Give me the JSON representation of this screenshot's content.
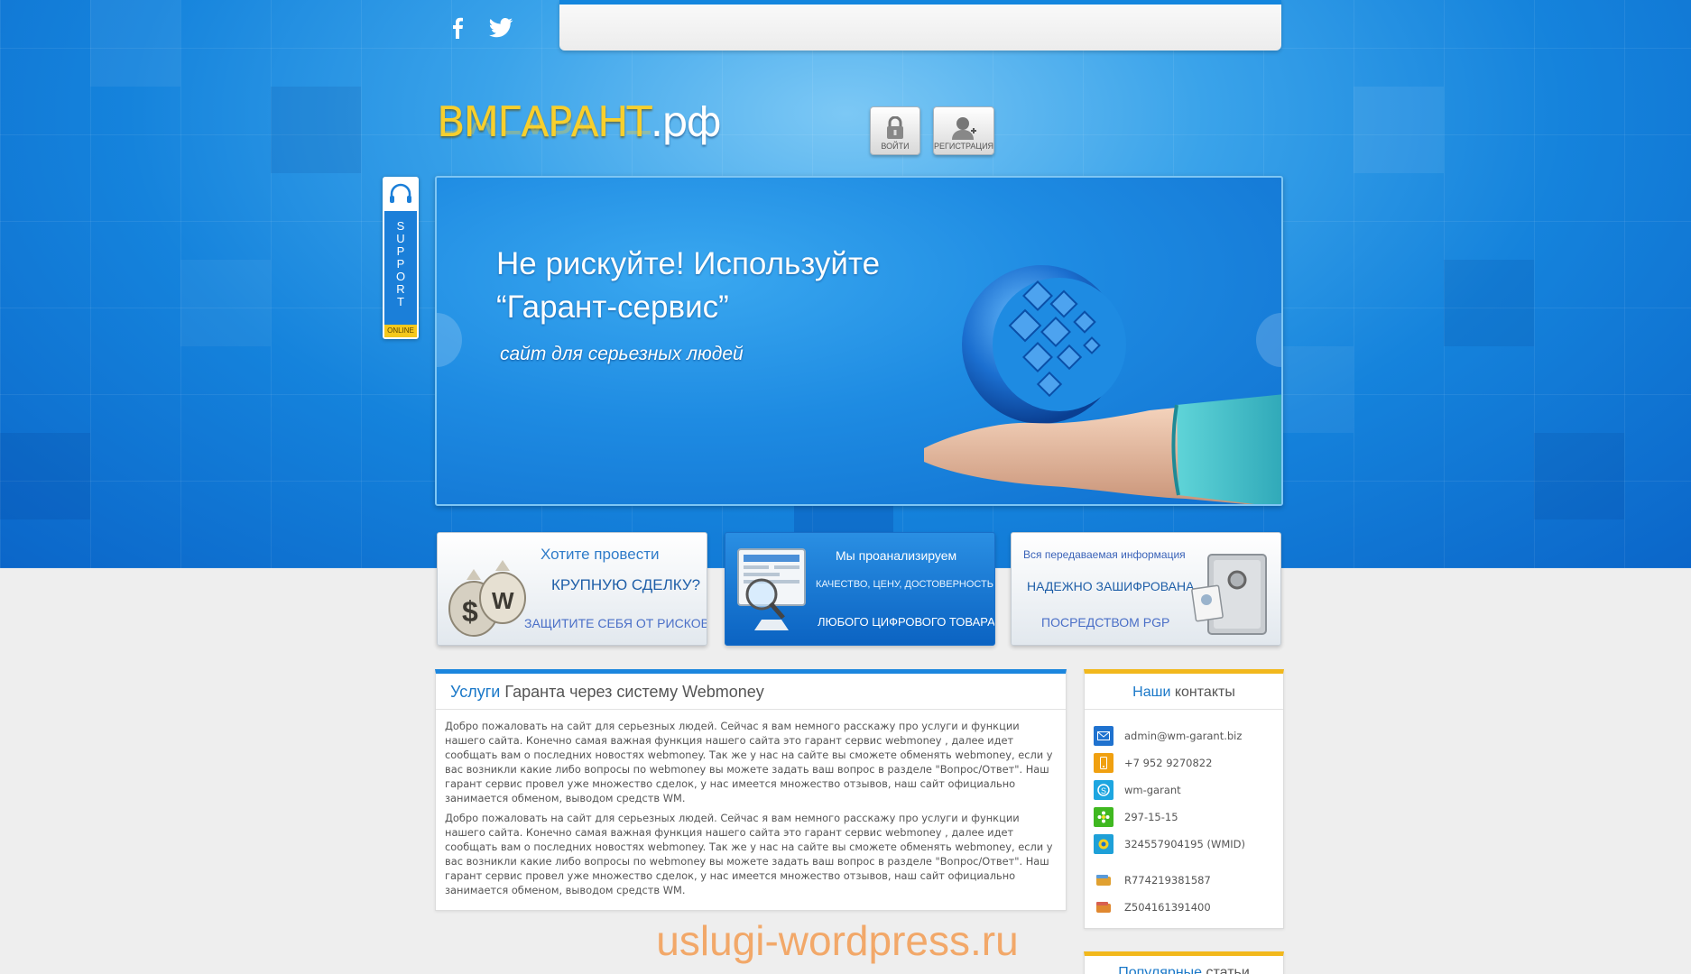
{
  "colors": {
    "accent": "#1a78c8",
    "brand_yellow": "#f7cf2d",
    "panel_border_orange": "#f2b81c"
  },
  "social": {
    "facebook_icon": "facebook-icon",
    "twitter_icon": "twitter-icon"
  },
  "logo": {
    "main": "ВМГАРАНТ",
    "domain": ".рф"
  },
  "auth": {
    "login_label": "ВОЙТИ",
    "register_label": "РЕГИСТРАЦИЯ"
  },
  "support": {
    "letters": [
      "S",
      "U",
      "P",
      "P",
      "O",
      "R",
      "T"
    ],
    "status": "ONLINE"
  },
  "hero": {
    "title_line1": "Не рискуйте! Используйте",
    "title_line2": "“Гарант-сервис”",
    "subtitle": "сайт для серьезных людей"
  },
  "features": [
    {
      "line1": "Хотите провести",
      "line2": "КРУПНУЮ СДЕЛКУ?",
      "line3": "ЗАЩИТИТЕ СЕБЯ ОТ РИСКОВ!"
    },
    {
      "line1": "Мы проанализируем",
      "line2": "КАЧЕСТВО, ЦЕНУ, ДОСТОВЕРНОСТЬ",
      "line3": "ЛЮБОГО ЦИФРОВОГО ТОВАРА"
    },
    {
      "line1": "Вся передаваемая информация",
      "line2": "НАДЕЖНО ЗАШИФРОВАНА",
      "line3": "ПОСРЕДСТВОМ PGP"
    }
  ],
  "services": {
    "title_accent": "Услуги",
    "title_rest": " Гаранта через систему Webmoney",
    "paragraphs": [
      "Добро пожаловать на сайт для серьезных людей. Сейчас я вам немного расскажу про услуги и функции нашего сайта. Конечно самая важная функция нашего сайта это гарант сервис webmoney , далее идет сообщать вам о последних новостях webmoney. Так же у нас на сайте вы сможете обменять webmoney, если у вас возникли какие либо вопросы по webmoney вы можете задать ваш вопрос в разделе \"Вопрос/Ответ\". Наш гарант сервис провел уже множество сделок, у нас имеется множество отзывов, наш сайт официально занимается обменом, выводом средств WM.",
      "Добро пожаловать на сайт для серьезных людей. Сейчас я вам немного расскажу про услуги и функции нашего сайта. Конечно самая важная функция нашего сайта это гарант сервис webmoney , далее идет сообщать вам о последних новостях webmoney. Так же у нас на сайте вы сможете обменять webmoney, если у вас возникли какие либо вопросы по webmoney вы можете задать ваш вопрос в разделе \"Вопрос/Ответ\". Наш гарант сервис провел уже множество сделок, у нас имеется множество отзывов, наш сайт официально занимается обменом, выводом средств WM."
    ]
  },
  "contacts": {
    "title_accent": "Наши",
    "title_rest": " контакты",
    "email": "admin@wm-garant.biz",
    "phone": "+7 952 9270822",
    "skype": "wm-garant",
    "icq": "297-15-15",
    "wmid": "324557904195 (WMID)",
    "purse_r": "R774219381587",
    "purse_z": "Z504161391400"
  },
  "popular": {
    "title_accent": "Популярные",
    "title_rest": " статьи"
  },
  "watermark": "uslugi-wordpress.ru"
}
